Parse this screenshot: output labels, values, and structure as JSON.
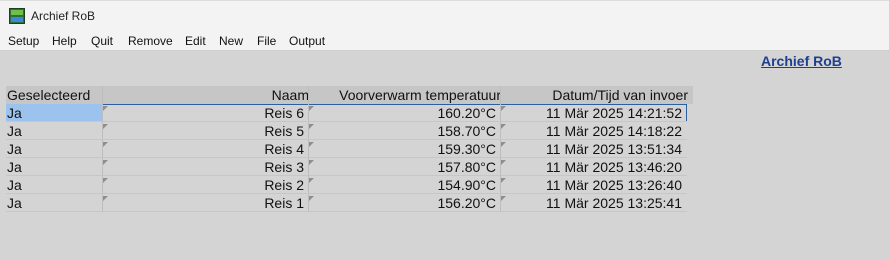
{
  "window": {
    "title": "Archief RoB",
    "app_icon": "app-icon"
  },
  "menu": [
    "Setup",
    "Help",
    "Quit",
    "Remove",
    "Edit",
    "New",
    "File",
    "Output"
  ],
  "heading_link": "Archief RoB",
  "table": {
    "columns": [
      "Geselecteerd",
      "Naam",
      "Voorverwarm temperatuur",
      "Datum/Tijd van invoer"
    ],
    "rows": [
      {
        "selected": "Ja",
        "name": "Reis 6",
        "temp": "160.20°C",
        "datetime": "11 Mär 2025  14:21:52"
      },
      {
        "selected": "Ja",
        "name": "Reis 5",
        "temp": "158.70°C",
        "datetime": "11 Mär 2025  14:18:22"
      },
      {
        "selected": "Ja",
        "name": "Reis 4",
        "temp": "159.30°C",
        "datetime": "11 Mär 2025  13:51:34"
      },
      {
        "selected": "Ja",
        "name": "Reis 3",
        "temp": "157.80°C",
        "datetime": "11 Mär 2025  13:46:20"
      },
      {
        "selected": "Ja",
        "name": "Reis 2",
        "temp": "154.90°C",
        "datetime": "11 Mär 2025  13:26:40"
      },
      {
        "selected": "Ja",
        "name": "Reis 1",
        "temp": "156.20°C",
        "datetime": "11 Mär 2025  13:25:41"
      }
    ],
    "active_row_index": 0
  },
  "colors": {
    "background": "#d4d4d4",
    "link": "#1f3f8f",
    "selection": "#9cc3ee",
    "selection_border": "#2b5f9f"
  }
}
